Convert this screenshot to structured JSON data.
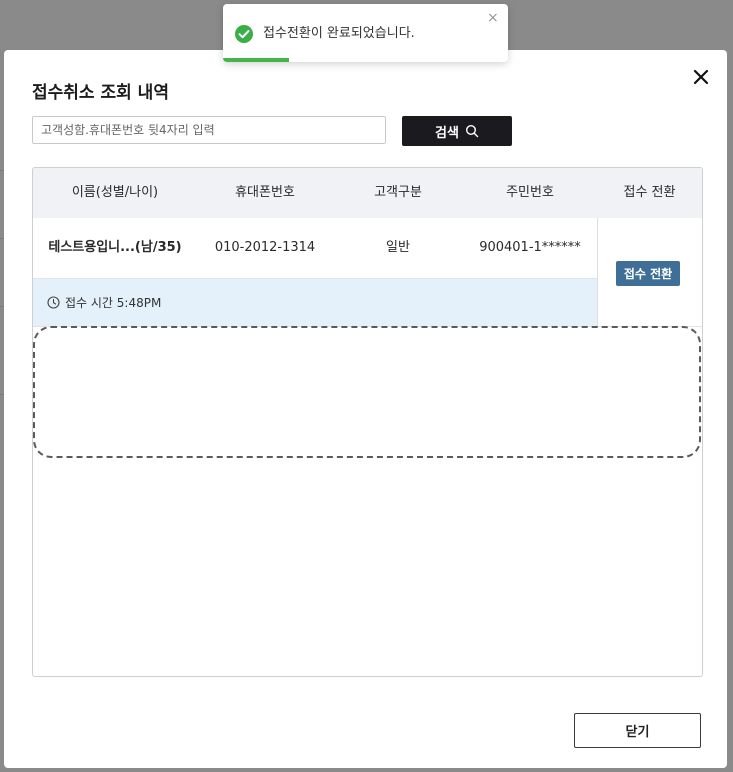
{
  "modal": {
    "title": "접수취소 조회 내역",
    "close_icon": "close-icon"
  },
  "search": {
    "placeholder": "고객성함.휴대폰번호 뒷4자리 입력",
    "value": "",
    "button_label": "검색",
    "button_icon": "search-icon"
  },
  "table": {
    "columns": [
      "이름(성별/나이)",
      "휴대폰번호",
      "고객구분",
      "주민번호",
      "접수 전환"
    ],
    "rows": [
      {
        "name": "테스트용입니...(남/35)",
        "phone": "010-2012-1314",
        "customer_type": "일반",
        "resident_no": "900401-1******",
        "received_time": "접수 시간 5:48PM",
        "action_label": "접수 전환"
      }
    ]
  },
  "footer": {
    "close_label": "닫기"
  },
  "toast": {
    "message": "접수전환이 완료되었습니다.",
    "icon": "check-circle-icon",
    "close": "×",
    "progress_fraction": 0.23,
    "progress_color": "#43b54a"
  },
  "colors": {
    "action_button": "#3f6f97",
    "search_button": "#1b1b1f",
    "highlight_row": "#e4f1fa"
  }
}
